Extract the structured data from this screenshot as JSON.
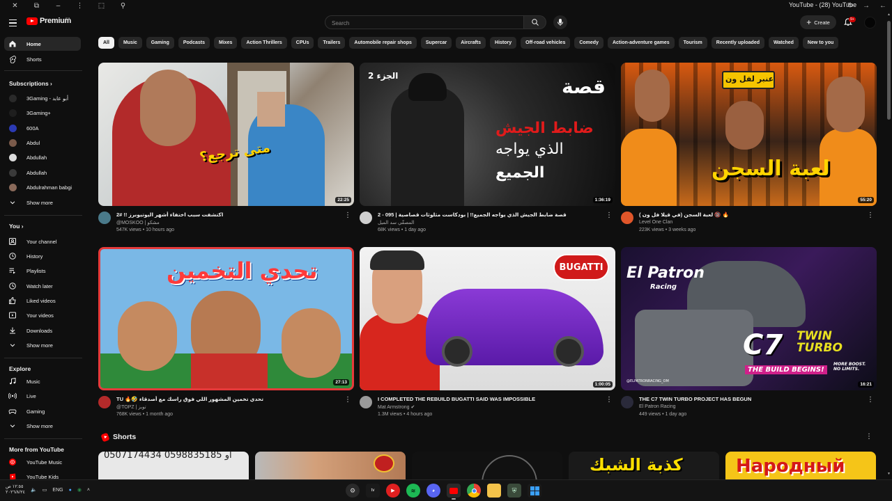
{
  "window": {
    "title": "YouTube - (28) YouTube"
  },
  "header": {
    "logo_text": "Premium",
    "logo_country": "SA",
    "search_placeholder": "Search",
    "create_label": "Create",
    "notifications_badge": "9+"
  },
  "sidebar": {
    "main": [
      {
        "label": "Home",
        "icon": "home-icon",
        "active": true
      },
      {
        "label": "Shorts",
        "icon": "shorts-icon",
        "active": false
      }
    ],
    "subscriptions_title": "Subscriptions",
    "subscriptions": [
      {
        "label": "3Gaming - أبو عابد",
        "color": "#2a2a2a"
      },
      {
        "label": "3Gaming+",
        "color": "#1e1e1e"
      },
      {
        "label": "600A",
        "color": "#2b3ab3"
      },
      {
        "label": "Abdul",
        "color": "#7a5a4a"
      },
      {
        "label": "Abdullah",
        "color": "#dcdcdc"
      },
      {
        "label": "Abdullah",
        "color": "#3a3a3a"
      },
      {
        "label": "Abdulrahman babgi",
        "color": "#8a6a5a"
      }
    ],
    "subscriptions_show_more": "Show more",
    "you_title": "You",
    "you": [
      {
        "label": "Your channel",
        "icon": "your-channel-icon"
      },
      {
        "label": "History",
        "icon": "history-icon"
      },
      {
        "label": "Playlists",
        "icon": "playlists-icon"
      },
      {
        "label": "Watch later",
        "icon": "watch-later-icon"
      },
      {
        "label": "Liked videos",
        "icon": "liked-videos-icon"
      },
      {
        "label": "Your videos",
        "icon": "your-videos-icon"
      },
      {
        "label": "Downloads",
        "icon": "downloads-icon"
      }
    ],
    "you_show_more": "Show more",
    "explore_title": "Explore",
    "explore": [
      {
        "label": "Music",
        "icon": "music-icon"
      },
      {
        "label": "Live",
        "icon": "live-icon"
      },
      {
        "label": "Gaming",
        "icon": "gaming-icon"
      }
    ],
    "explore_show_more": "Show more",
    "more_title": "More from YouTube",
    "more": [
      {
        "label": "YouTube Music",
        "icon": "youtube-music-icon"
      },
      {
        "label": "YouTube Kids",
        "icon": "youtube-kids-icon"
      }
    ]
  },
  "chips": [
    "All",
    "Music",
    "Gaming",
    "Podcasts",
    "Mixes",
    "Action Thrillers",
    "CPUs",
    "Trailers",
    "Automobile repair shops",
    "Supercar",
    "Aircrafts",
    "History",
    "Off-road vehicles",
    "Comedy",
    "Action-adventure games",
    "Tourism",
    "Recently uploaded",
    "Watched",
    "New to you"
  ],
  "videos": [
    {
      "title": "اكتشفت سبب اختفاء أشهر اليوتيوبرز !! #2",
      "channel": "@MOSKOO | مشكو",
      "stats": "547K views • 10 hours ago",
      "duration": "22:25",
      "avatar_color": "#4a7a8a",
      "thumb_text": "متى ترجع؟"
    },
    {
      "title": "2 - 095 | قصة ضابط الجيش الذي يواجه الجميع!! | بودكاست مثلوثات قصاصية",
      "channel": "المصفّي سد الميل",
      "stats": "68K views • 1 day ago",
      "duration": "1:36:19",
      "avatar_color": "#cfcfcf",
      "thumb_text": "قصة",
      "thumb_part": "الجزء 2",
      "thumb_red": "ضابط الجيش",
      "thumb_white1": "الذي يواجه",
      "thumb_white2": "الجميع"
    },
    {
      "title": "لعبة السجن (في قيلا فل ون ) 🔞 🔥",
      "channel": "Level One Clan",
      "stats": "223K views • 3 weeks ago",
      "duration": "55:20",
      "avatar_color": "#e0562a",
      "thumb_text": "لعبة السجن",
      "thumb_sign": "عنبر لفل ون"
    },
    {
      "title": "TU 🔥🤣 تحدي تخمين المشهور اللي فوق راسك مع أصدقاء",
      "channel": "@TOPZ | توبز",
      "stats": "768K views • 1 month ago",
      "duration": "27:13",
      "avatar_color": "#b42a2a",
      "thumb_text": "تحدي التخمين"
    },
    {
      "title": "I COMPLETED THE REBUILD BUGATTI SAID WAS IMPOSSIBLE",
      "channel": "Mat Armstrong",
      "stats": "1.3M views • 4 hours ago",
      "duration": "1:00:05",
      "avatar_color": "#9a9a9a",
      "thumb_text": "BUGATTI"
    },
    {
      "title": "THE C7 TWIN TURBO PROJECT HAS BEGUN",
      "channel": "El Patron Racing",
      "stats": "449 views • 1 day ago",
      "duration": "16:21",
      "avatar_color": "#2a2a3a",
      "thumb_text": "C7",
      "thumb_text2": "TWIN TURBO",
      "thumb_sub": "THE BUILD BEGINS!",
      "thumb_brand": "El Patron",
      "thumb_brand_sub": "Racing",
      "thumb_tag": "MORE BOOST. NO LIMITS.",
      "thumb_handle": "@ELPATRONRACING_OM"
    }
  ],
  "shorts": {
    "title": "Shorts",
    "items": [
      {
        "text": "0507174434 أو 0598835185",
        "bg": "#e8e8e8"
      },
      {
        "text": "",
        "bg": "#b37a55"
      },
      {
        "text": "",
        "bg": "#111111"
      },
      {
        "text": "كذبة الشبك",
        "bg": "#1a1a1a"
      },
      {
        "text": "Народный",
        "bg": "#f5c518"
      }
    ]
  },
  "taskbar": {
    "language": "ENG",
    "time": "١٢:٥٥ ص",
    "date": "٢٠٢٦/٨/٢٤"
  },
  "colors": {
    "accent": "#ff0000",
    "background": "#0f0f0f",
    "chip_bg": "#272727"
  }
}
